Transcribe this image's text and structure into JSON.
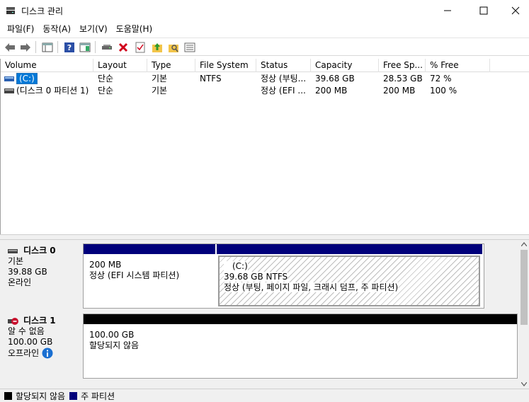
{
  "window": {
    "title": "디스크 관리",
    "controls": [
      "minimize-icon",
      "maximize-icon",
      "close-icon"
    ]
  },
  "menu": [
    "파일(F)",
    "동작(A)",
    "보기(V)",
    "도움말(H)"
  ],
  "toolbar": {
    "buttons": [
      "back-arrow-icon",
      "forward-arrow-icon",
      "console-tree-icon",
      "help-icon",
      "action-pane-icon",
      "connect-drive-icon",
      "delete-icon",
      "properties-icon",
      "up-folder-icon",
      "search-folder-icon",
      "list-view-icon"
    ]
  },
  "volume_list": {
    "columns": [
      "Volume",
      "Layout",
      "Type",
      "File System",
      "Status",
      "Capacity",
      "Free Sp...",
      "% Free"
    ],
    "rows": [
      {
        "volume": "(C:)",
        "layout": "단순",
        "type": "기본",
        "fs": "NTFS",
        "status": "정상 (부팅...",
        "capacity": "39.68 GB",
        "free": "28.53 GB",
        "pct": "72 %"
      },
      {
        "volume": "(디스크 0 파티션 1)",
        "layout": "단순",
        "type": "기본",
        "fs": "",
        "status": "정상 (EFI ...",
        "capacity": "200 MB",
        "free": "200 MB",
        "pct": "100 %"
      }
    ]
  },
  "disks": [
    {
      "name": "디스크 0",
      "type": "기본",
      "size": "39.88 GB",
      "state": "온라인",
      "partitions": [
        {
          "line1": "200 MB",
          "line2": "정상 (EFI 시스템 파티션)"
        },
        {
          "label": "(C:)",
          "line1": "39.68 GB NTFS",
          "line2": "정상 (부팅, 페이지 파일, 크래시 덤프, 주 파티션)"
        }
      ]
    },
    {
      "name": "디스크 1",
      "type": "알 수 없음",
      "size": "100.00 GB",
      "state": "오프라인",
      "partitions": [
        {
          "line1": "100.00 GB",
          "line2": "할당되지 않음"
        }
      ]
    }
  ],
  "legend": [
    {
      "label": "할당되지 않음",
      "color": "#000000"
    },
    {
      "label": "주 파티션",
      "color": "#00007b"
    }
  ],
  "colors": {
    "primary_partition": "#00007b",
    "unallocated": "#000000",
    "selection": "#0078d7"
  }
}
